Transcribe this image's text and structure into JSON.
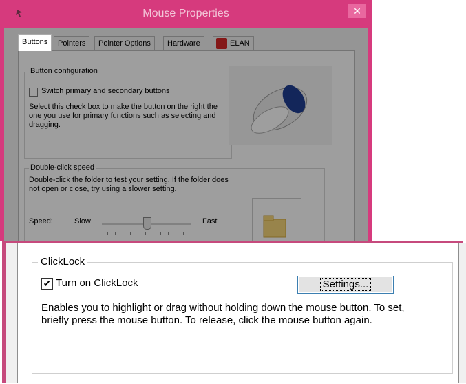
{
  "colors": {
    "accent": "#d63a7d",
    "title_text": "#f3c6d8"
  },
  "window": {
    "title": "Mouse Properties",
    "close_glyph": "✕"
  },
  "tabs": [
    {
      "label": "Buttons",
      "active": true
    },
    {
      "label": "Pointers"
    },
    {
      "label": "Pointer Options"
    },
    {
      "label": "Hardware"
    },
    {
      "label": "ELAN",
      "icon": "elan-icon"
    }
  ],
  "button_config": {
    "title": "Button configuration",
    "checkbox_label": "Switch primary and secondary buttons",
    "checkbox_checked": false,
    "description": "Select this check box to make the button on the right the one you use for primary functions such as selecting and dragging."
  },
  "double_click": {
    "title": "Double-click speed",
    "description": "Double-click the folder to test your setting. If the folder does not open or close, try using a slower setting.",
    "speed_label": "Speed:",
    "slow_label": "Slow",
    "fast_label": "Fast",
    "speed_value": 0.55
  },
  "clicklock": {
    "title": "ClickLock",
    "checkbox_label": "Turn on ClickLock",
    "checkbox_checked": true,
    "check_glyph": "✔",
    "settings_label": "Settings...",
    "description": "Enables you to highlight or drag without holding down the mouse button. To set, briefly press the mouse button. To release, click the mouse button again."
  }
}
